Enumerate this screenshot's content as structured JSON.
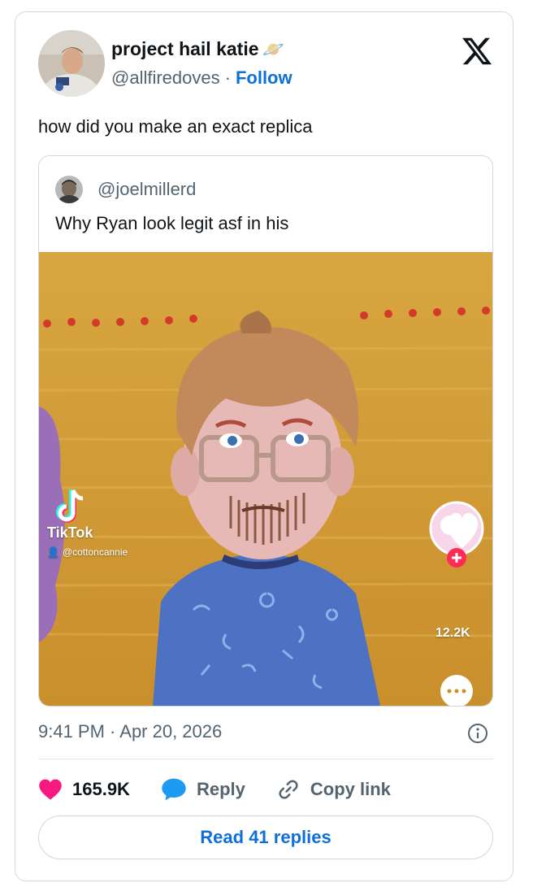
{
  "author": {
    "display_name": "project hail katie",
    "name_emoji": "🪐",
    "handle": "@allfiredoves",
    "separator": "·",
    "follow_label": "Follow"
  },
  "tweet": {
    "text": "how did you make an exact replica",
    "timestamp": "9:41 PM · Apr 20, 2026"
  },
  "quoted": {
    "handle": "@joelmillerd",
    "text": "Why Ryan look legit asf in his",
    "media": {
      "watermark_app": "TikTok",
      "watermark_user": "@cottoncannie",
      "like_count": "12.2K"
    }
  },
  "actions": {
    "likes": "165.9K",
    "reply_label": "Reply",
    "copy_label": "Copy link"
  },
  "read_replies_label": "Read 41 replies",
  "colors": {
    "accent": "#0f6fd8",
    "like": "#f91880",
    "reply": "#1d9bf0",
    "border": "#cfd9de",
    "muted": "#536471"
  }
}
